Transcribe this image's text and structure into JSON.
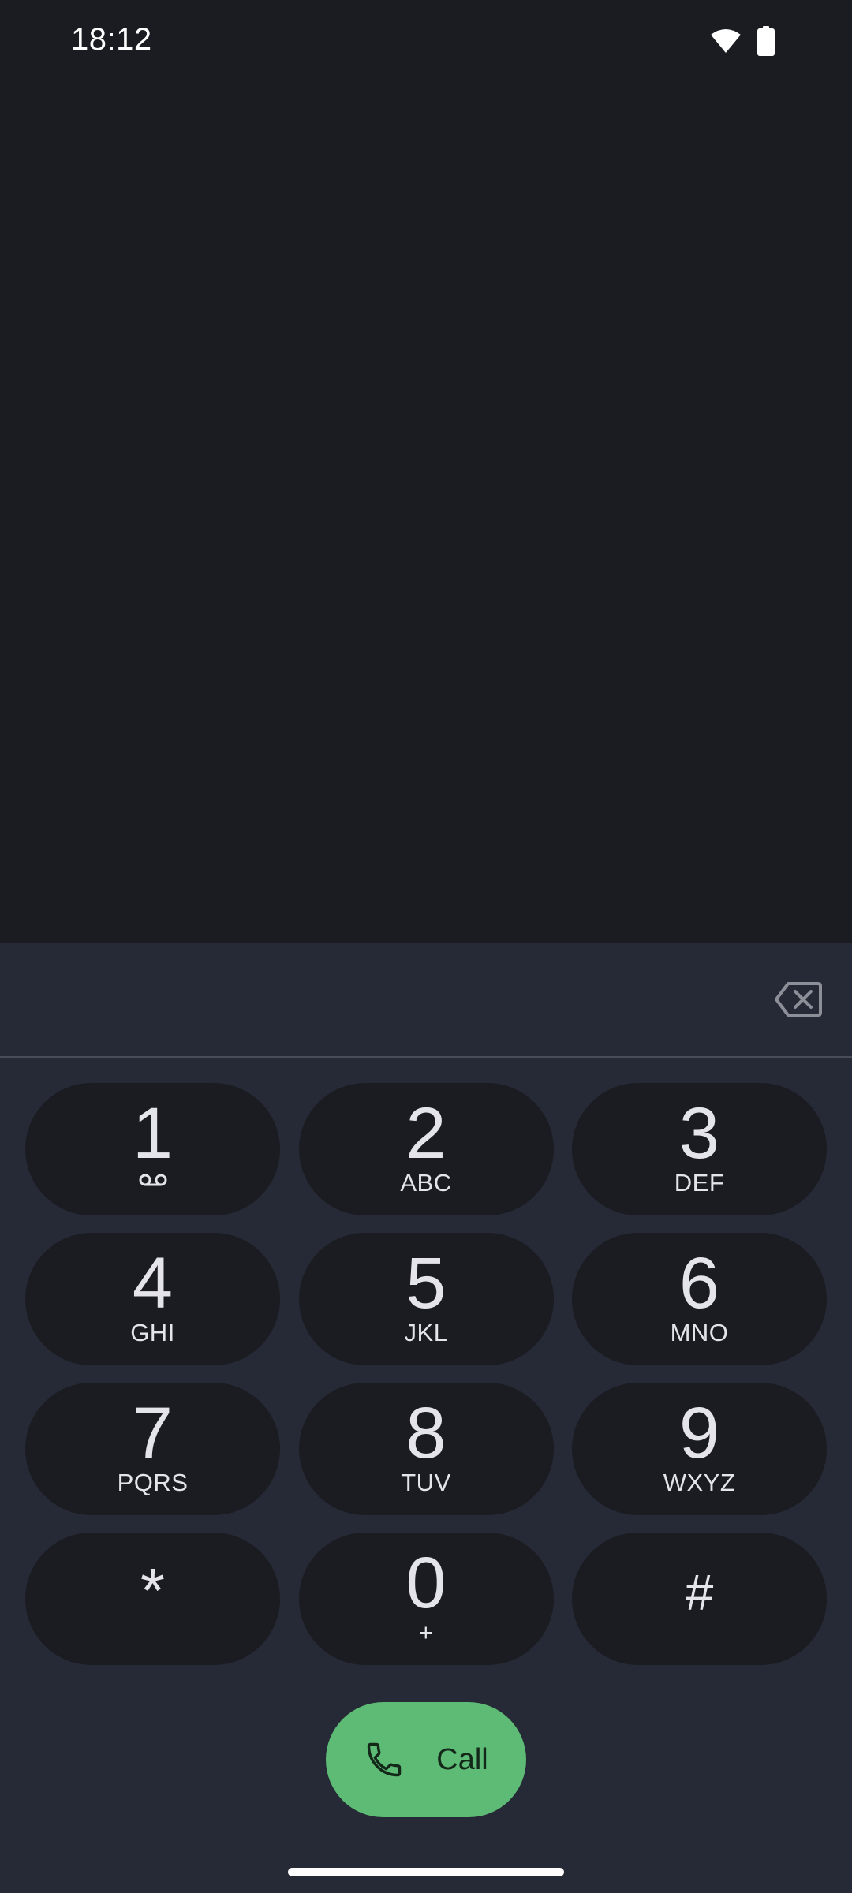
{
  "status_bar": {
    "time": "18:12",
    "icons": [
      "wifi-icon",
      "battery-icon"
    ]
  },
  "dialer": {
    "number_display": "",
    "backspace_icon": "backspace-icon",
    "keys": [
      {
        "digit": "1",
        "letters": "",
        "sub_icon": "voicemail-icon"
      },
      {
        "digit": "2",
        "letters": "ABC"
      },
      {
        "digit": "3",
        "letters": "DEF"
      },
      {
        "digit": "4",
        "letters": "GHI"
      },
      {
        "digit": "5",
        "letters": "JKL"
      },
      {
        "digit": "6",
        "letters": "MNO"
      },
      {
        "digit": "7",
        "letters": "PQRS"
      },
      {
        "digit": "8",
        "letters": "TUV"
      },
      {
        "digit": "9",
        "letters": "WXYZ"
      },
      {
        "symbol": "*"
      },
      {
        "digit": "0",
        "letters": "+"
      },
      {
        "symbol": "#"
      }
    ],
    "call_button": {
      "label": "Call",
      "icon": "phone-icon",
      "color": "#5dbb75"
    }
  },
  "colors": {
    "background": "#1b1c21",
    "sheet": "#262936",
    "key": "#1b1c21",
    "text": "#e4e4ea"
  }
}
